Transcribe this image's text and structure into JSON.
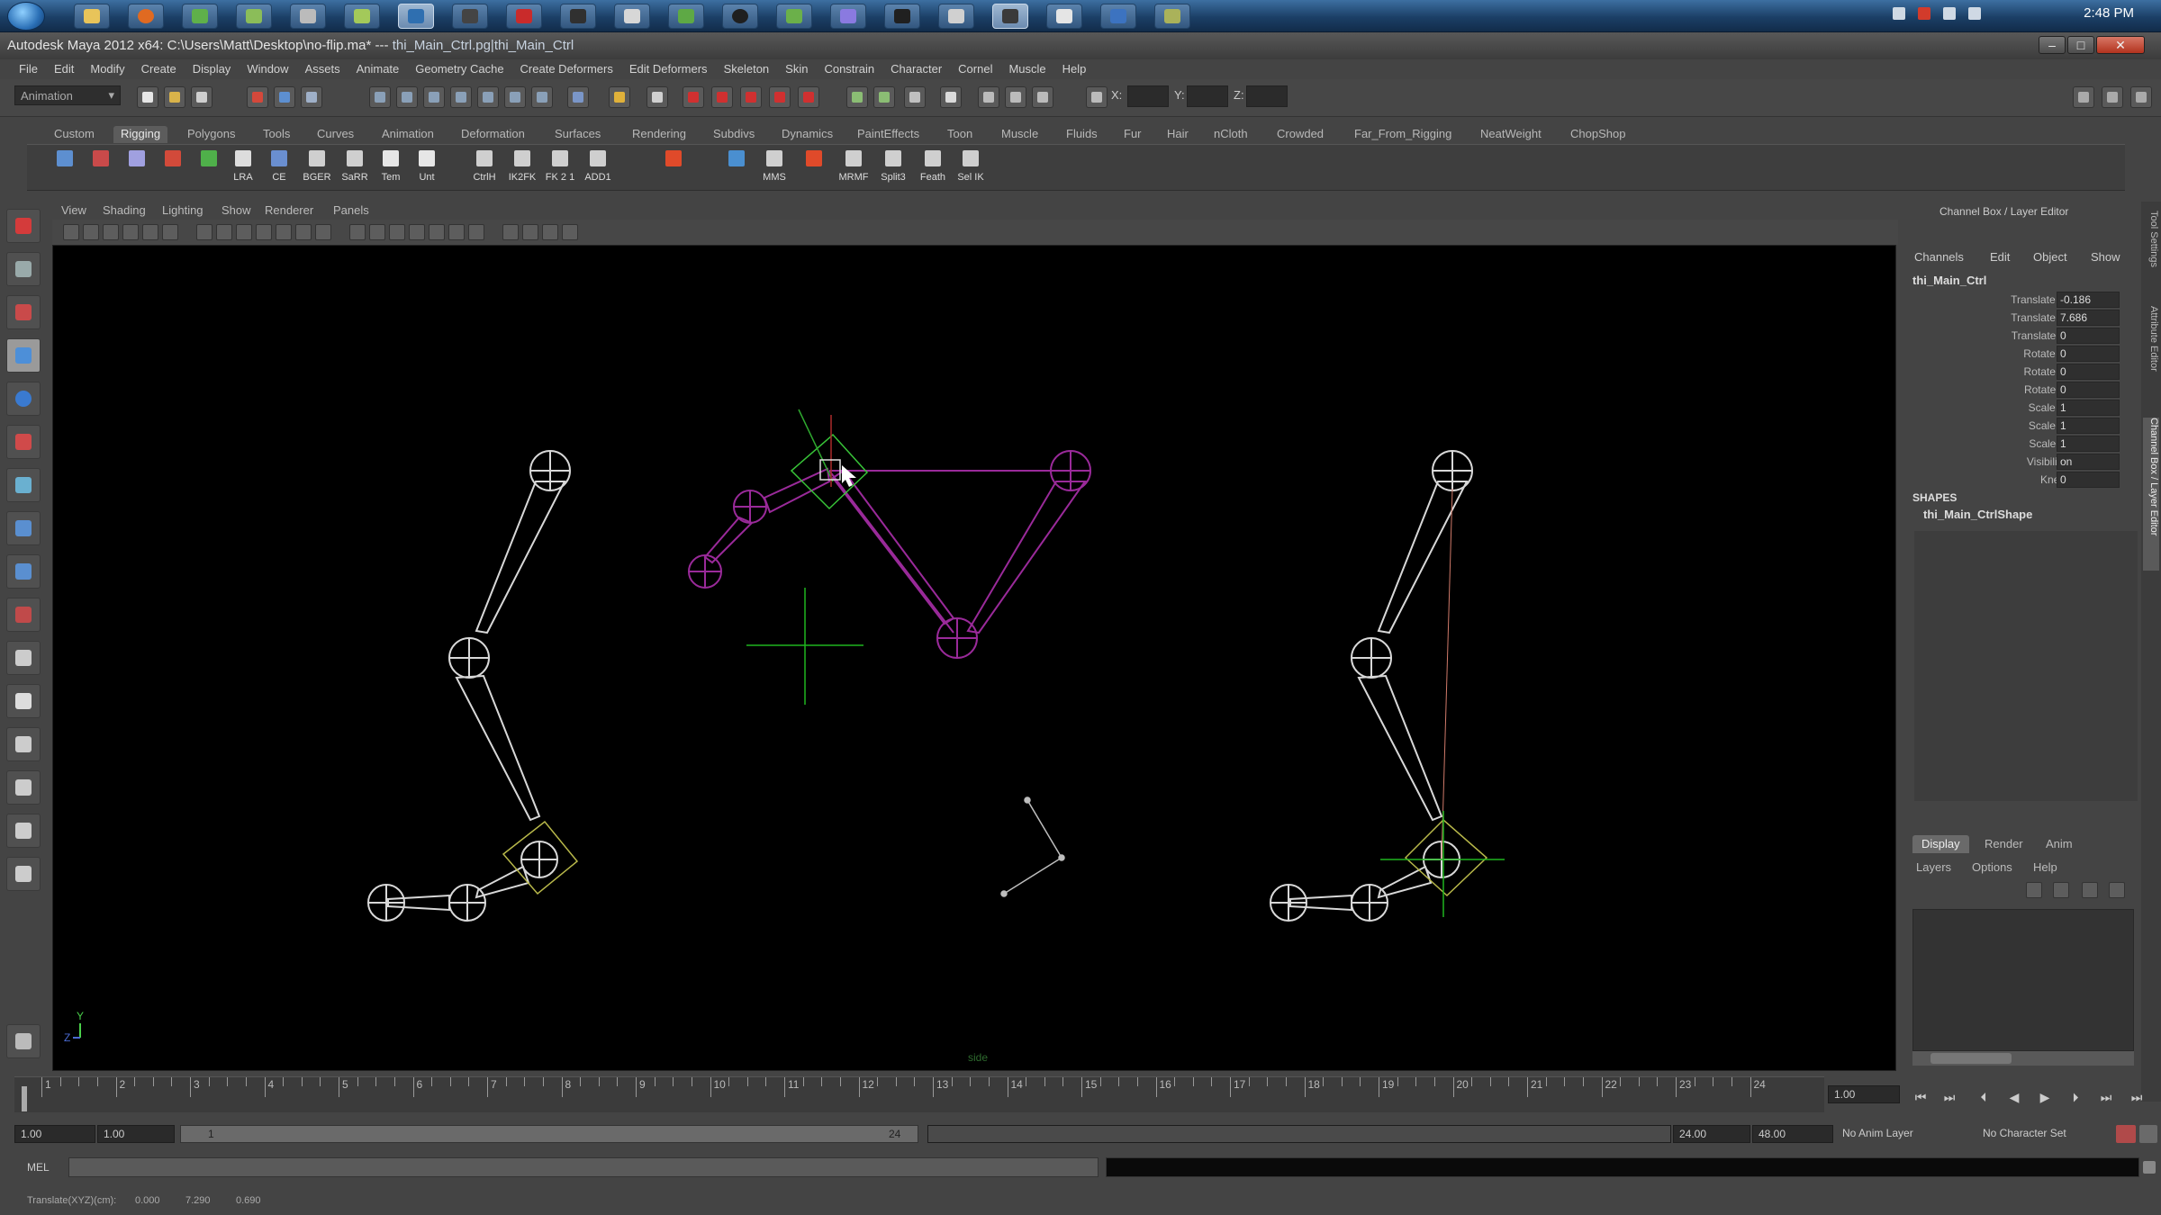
{
  "taskbar": {
    "clock": "2:48 PM"
  },
  "window": {
    "title": "Autodesk Maya 2012 x64: C:\\Users\\Matt\\Desktop\\no-flip.ma*",
    "separator": "---",
    "selection": "thi_Main_Ctrl.pg|thi_Main_Ctrl"
  },
  "menubar": {
    "items": [
      "File",
      "Edit",
      "Modify",
      "Create",
      "Display",
      "Window",
      "Assets",
      "Animate",
      "Geometry Cache",
      "Create Deformers",
      "Edit Deformers",
      "Skeleton",
      "Skin",
      "Constrain",
      "Character",
      "Cornel",
      "Muscle",
      "Help"
    ]
  },
  "statusline": {
    "mode": "Animation",
    "x_label": "X:",
    "y_label": "Y:",
    "z_label": "Z:"
  },
  "shelf": {
    "tabs": [
      "Custom",
      "Rigging",
      "Polygons",
      "Tools",
      "Curves",
      "Animation",
      "Deformation",
      "Surfaces",
      "Rendering",
      "Subdivs",
      "Dynamics",
      "PaintEffects",
      "Toon",
      "Muscle",
      "Fluids",
      "Fur",
      "Hair",
      "nCloth",
      "Crowded",
      "Far_From_Rigging",
      "NeatWeight",
      "ChopShop"
    ],
    "active_tab": "Rigging",
    "button_labels": [
      "LRA",
      "CE",
      "BGER",
      "SaRR",
      "Tem",
      "Unt",
      "CtrlH",
      "IK2FK",
      "FK 2 1",
      "ADD1",
      "MMS",
      "MRMF",
      "Split3",
      "Feath",
      "Sel IK"
    ]
  },
  "panel": {
    "menu": [
      "View",
      "Shading",
      "Lighting",
      "Show",
      "Renderer",
      "Panels"
    ],
    "camera_label": "side",
    "axis_y": "Y",
    "axis_z": "Z"
  },
  "channelbox": {
    "header": "Channel Box / Layer Editor",
    "menu": [
      "Channels",
      "Edit",
      "Object",
      "Show"
    ],
    "object": "thi_Main_Ctrl",
    "channels": [
      {
        "name": "Translate X",
        "value": "-0.186"
      },
      {
        "name": "Translate Y",
        "value": "7.686"
      },
      {
        "name": "Translate Z",
        "value": "0"
      },
      {
        "name": "Rotate X",
        "value": "0"
      },
      {
        "name": "Rotate Y",
        "value": "0"
      },
      {
        "name": "Rotate Z",
        "value": "0"
      },
      {
        "name": "Scale X",
        "value": "1"
      },
      {
        "name": "Scale Y",
        "value": "1"
      },
      {
        "name": "Scale Z",
        "value": "1"
      },
      {
        "name": "Visibility",
        "value": "on"
      },
      {
        "name": "Knee",
        "value": "0"
      }
    ],
    "shapes_header": "SHAPES",
    "shape": "thi_Main_CtrlShape"
  },
  "layers": {
    "tabs": [
      "Display",
      "Render",
      "Anim"
    ],
    "menu": [
      "Layers",
      "Options",
      "Help"
    ]
  },
  "side_tabs": [
    "Tool Settings",
    "Attribute Editor",
    "Channel Box / Layer Editor"
  ],
  "timeline": {
    "frames": [
      "1",
      "2",
      "3",
      "4",
      "5",
      "6",
      "7",
      "8",
      "9",
      "10",
      "11",
      "12",
      "13",
      "14",
      "15",
      "16",
      "17",
      "18",
      "19",
      "20",
      "21",
      "22",
      "23",
      "24"
    ],
    "current_frame": "1.00",
    "range_start": "1.00",
    "range_start_inner": "1.00",
    "range_handle_start": "1",
    "range_handle_end": "24",
    "range_end": "24.00",
    "range_end_outer": "48.00",
    "anim_layer": "No Anim Layer",
    "character_set": "No Character Set"
  },
  "mel": {
    "label": "MEL"
  },
  "helpline": {
    "label": "Translate(XYZ)(cm):",
    "x": "0.000",
    "y": "7.290",
    "z": "0.690"
  }
}
